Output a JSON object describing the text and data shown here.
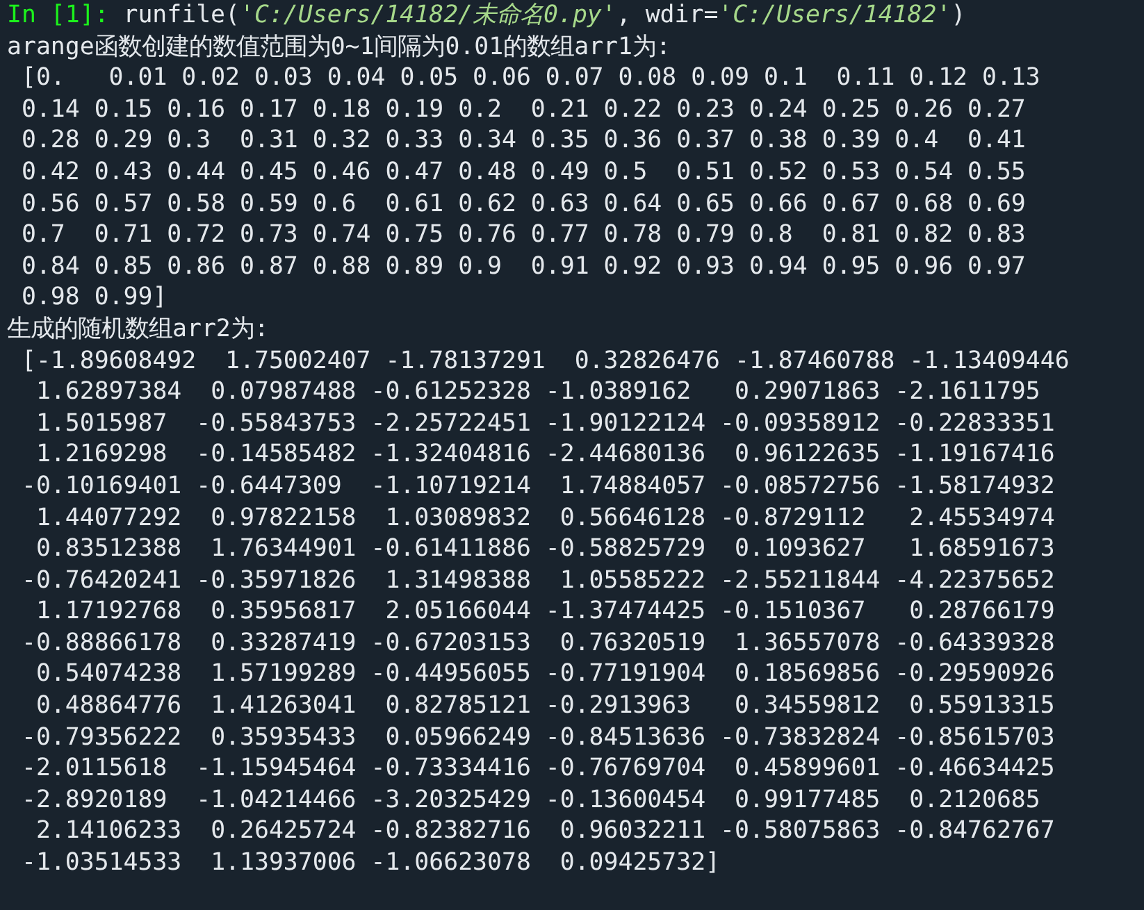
{
  "console": {
    "prompt": {
      "label": "In [1]:",
      "segments": [
        {
          "kind": "code",
          "text": "runfile("
        },
        {
          "kind": "string",
          "text": "'C:/Users/14182/未命名0.py'"
        },
        {
          "kind": "code",
          "text": ", wdir="
        },
        {
          "kind": "string",
          "text": "'C:/Users/14182'"
        },
        {
          "kind": "code",
          "text": ")"
        }
      ]
    },
    "output_lines": [
      "arange函数创建的数值范围为0~1间隔为0.01的数组arr1为:",
      " [0.   0.01 0.02 0.03 0.04 0.05 0.06 0.07 0.08 0.09 0.1  0.11 0.12 0.13",
      " 0.14 0.15 0.16 0.17 0.18 0.19 0.2  0.21 0.22 0.23 0.24 0.25 0.26 0.27",
      " 0.28 0.29 0.3  0.31 0.32 0.33 0.34 0.35 0.36 0.37 0.38 0.39 0.4  0.41",
      " 0.42 0.43 0.44 0.45 0.46 0.47 0.48 0.49 0.5  0.51 0.52 0.53 0.54 0.55",
      " 0.56 0.57 0.58 0.59 0.6  0.61 0.62 0.63 0.64 0.65 0.66 0.67 0.68 0.69",
      " 0.7  0.71 0.72 0.73 0.74 0.75 0.76 0.77 0.78 0.79 0.8  0.81 0.82 0.83",
      " 0.84 0.85 0.86 0.87 0.88 0.89 0.9  0.91 0.92 0.93 0.94 0.95 0.96 0.97",
      " 0.98 0.99]",
      "生成的随机数组arr2为:",
      " [-1.89608492  1.75002407 -1.78137291  0.32826476 -1.87460788 -1.13409446",
      "  1.62897384  0.07987488 -0.61252328 -1.0389162   0.29071863 -2.1611795",
      "  1.5015987  -0.55843753 -2.25722451 -1.90122124 -0.09358912 -0.22833351",
      "  1.2169298  -0.14585482 -1.32404816 -2.44680136  0.96122635 -1.19167416",
      " -0.10169401 -0.6447309  -1.10719214  1.74884057 -0.08572756 -1.58174932",
      "  1.44077292  0.97822158  1.03089832  0.56646128 -0.8729112   2.45534974",
      "  0.83512388  1.76344901 -0.61411886 -0.58825729  0.1093627   1.68591673",
      " -0.76420241 -0.35971826  1.31498388  1.05585222 -2.55211844 -4.22375652",
      "  1.17192768  0.35956817  2.05166044 -1.37474425 -0.1510367   0.28766179",
      " -0.88866178  0.33287419 -0.67203153  0.76320519  1.36557078 -0.64339328",
      "  0.54074238  1.57199289 -0.44956055 -0.77191904  0.18569856 -0.29590926",
      "  0.48864776  1.41263041  0.82785121 -0.2913963   0.34559812  0.55913315",
      " -0.79356222  0.35935433  0.05966249 -0.84513636 -0.73832824 -0.85615703",
      " -2.0115618  -1.15945464 -0.73334416 -0.76769704  0.45899601 -0.46634425",
      " -2.8920189  -1.04214466 -3.20325429 -0.13600454  0.99177485  0.2120685",
      "  2.14106233  0.26425724 -0.82382716  0.96032211 -0.58075863 -0.84762767",
      " -1.03514533  1.13937006 -1.06623078  0.09425732]"
    ]
  }
}
